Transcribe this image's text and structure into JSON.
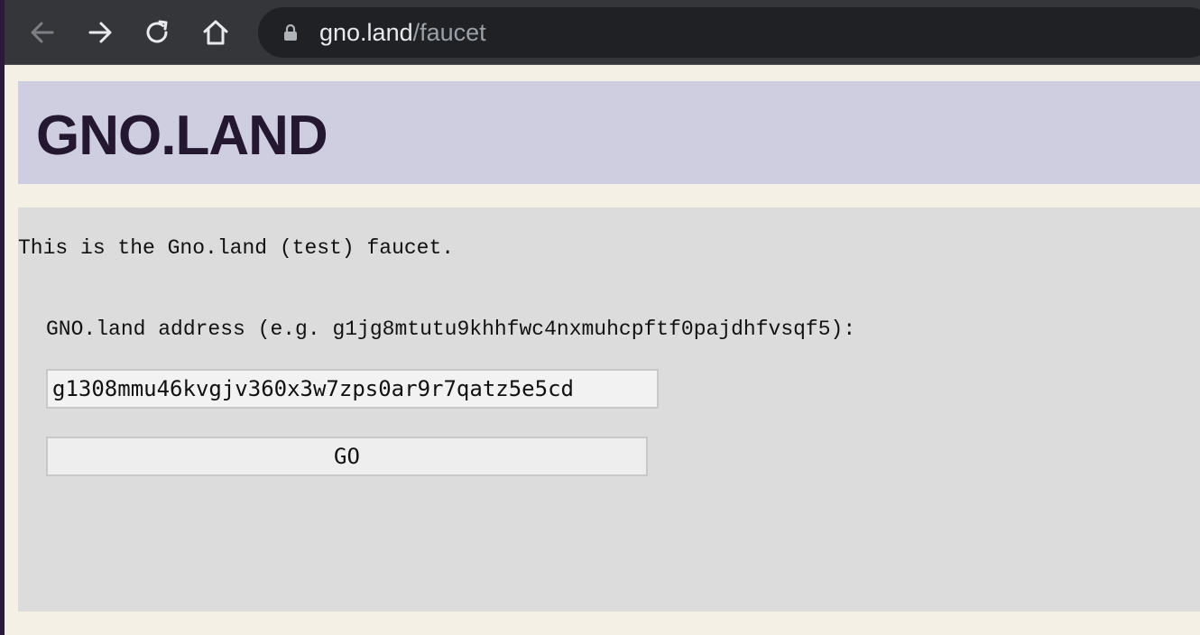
{
  "browser": {
    "url_domain": "gno.land",
    "url_path": "/faucet",
    "icons": [
      "back-arrow-icon",
      "forward-arrow-icon",
      "reload-icon",
      "home-icon",
      "lock-icon"
    ]
  },
  "header": {
    "title": "GNO.LAND"
  },
  "main": {
    "intro_text": "This is the Gno.land (test) faucet.",
    "address_label": "GNO.land address (e.g. g1jg8mtutu9khhfwc4nxmuhcpftf0pajdhfvsqf5):",
    "address_value": "g1308mmu46kvgjv360x3w7zps0ar9r7qatz5e5cd",
    "go_label": "GO"
  },
  "colors": {
    "page_background": "#f5f0e6",
    "header_band": "#cfcde0",
    "title_text": "#241830",
    "panel_background": "#dcdcdc",
    "toolbar": "#35363a",
    "omnibox": "#202124"
  }
}
